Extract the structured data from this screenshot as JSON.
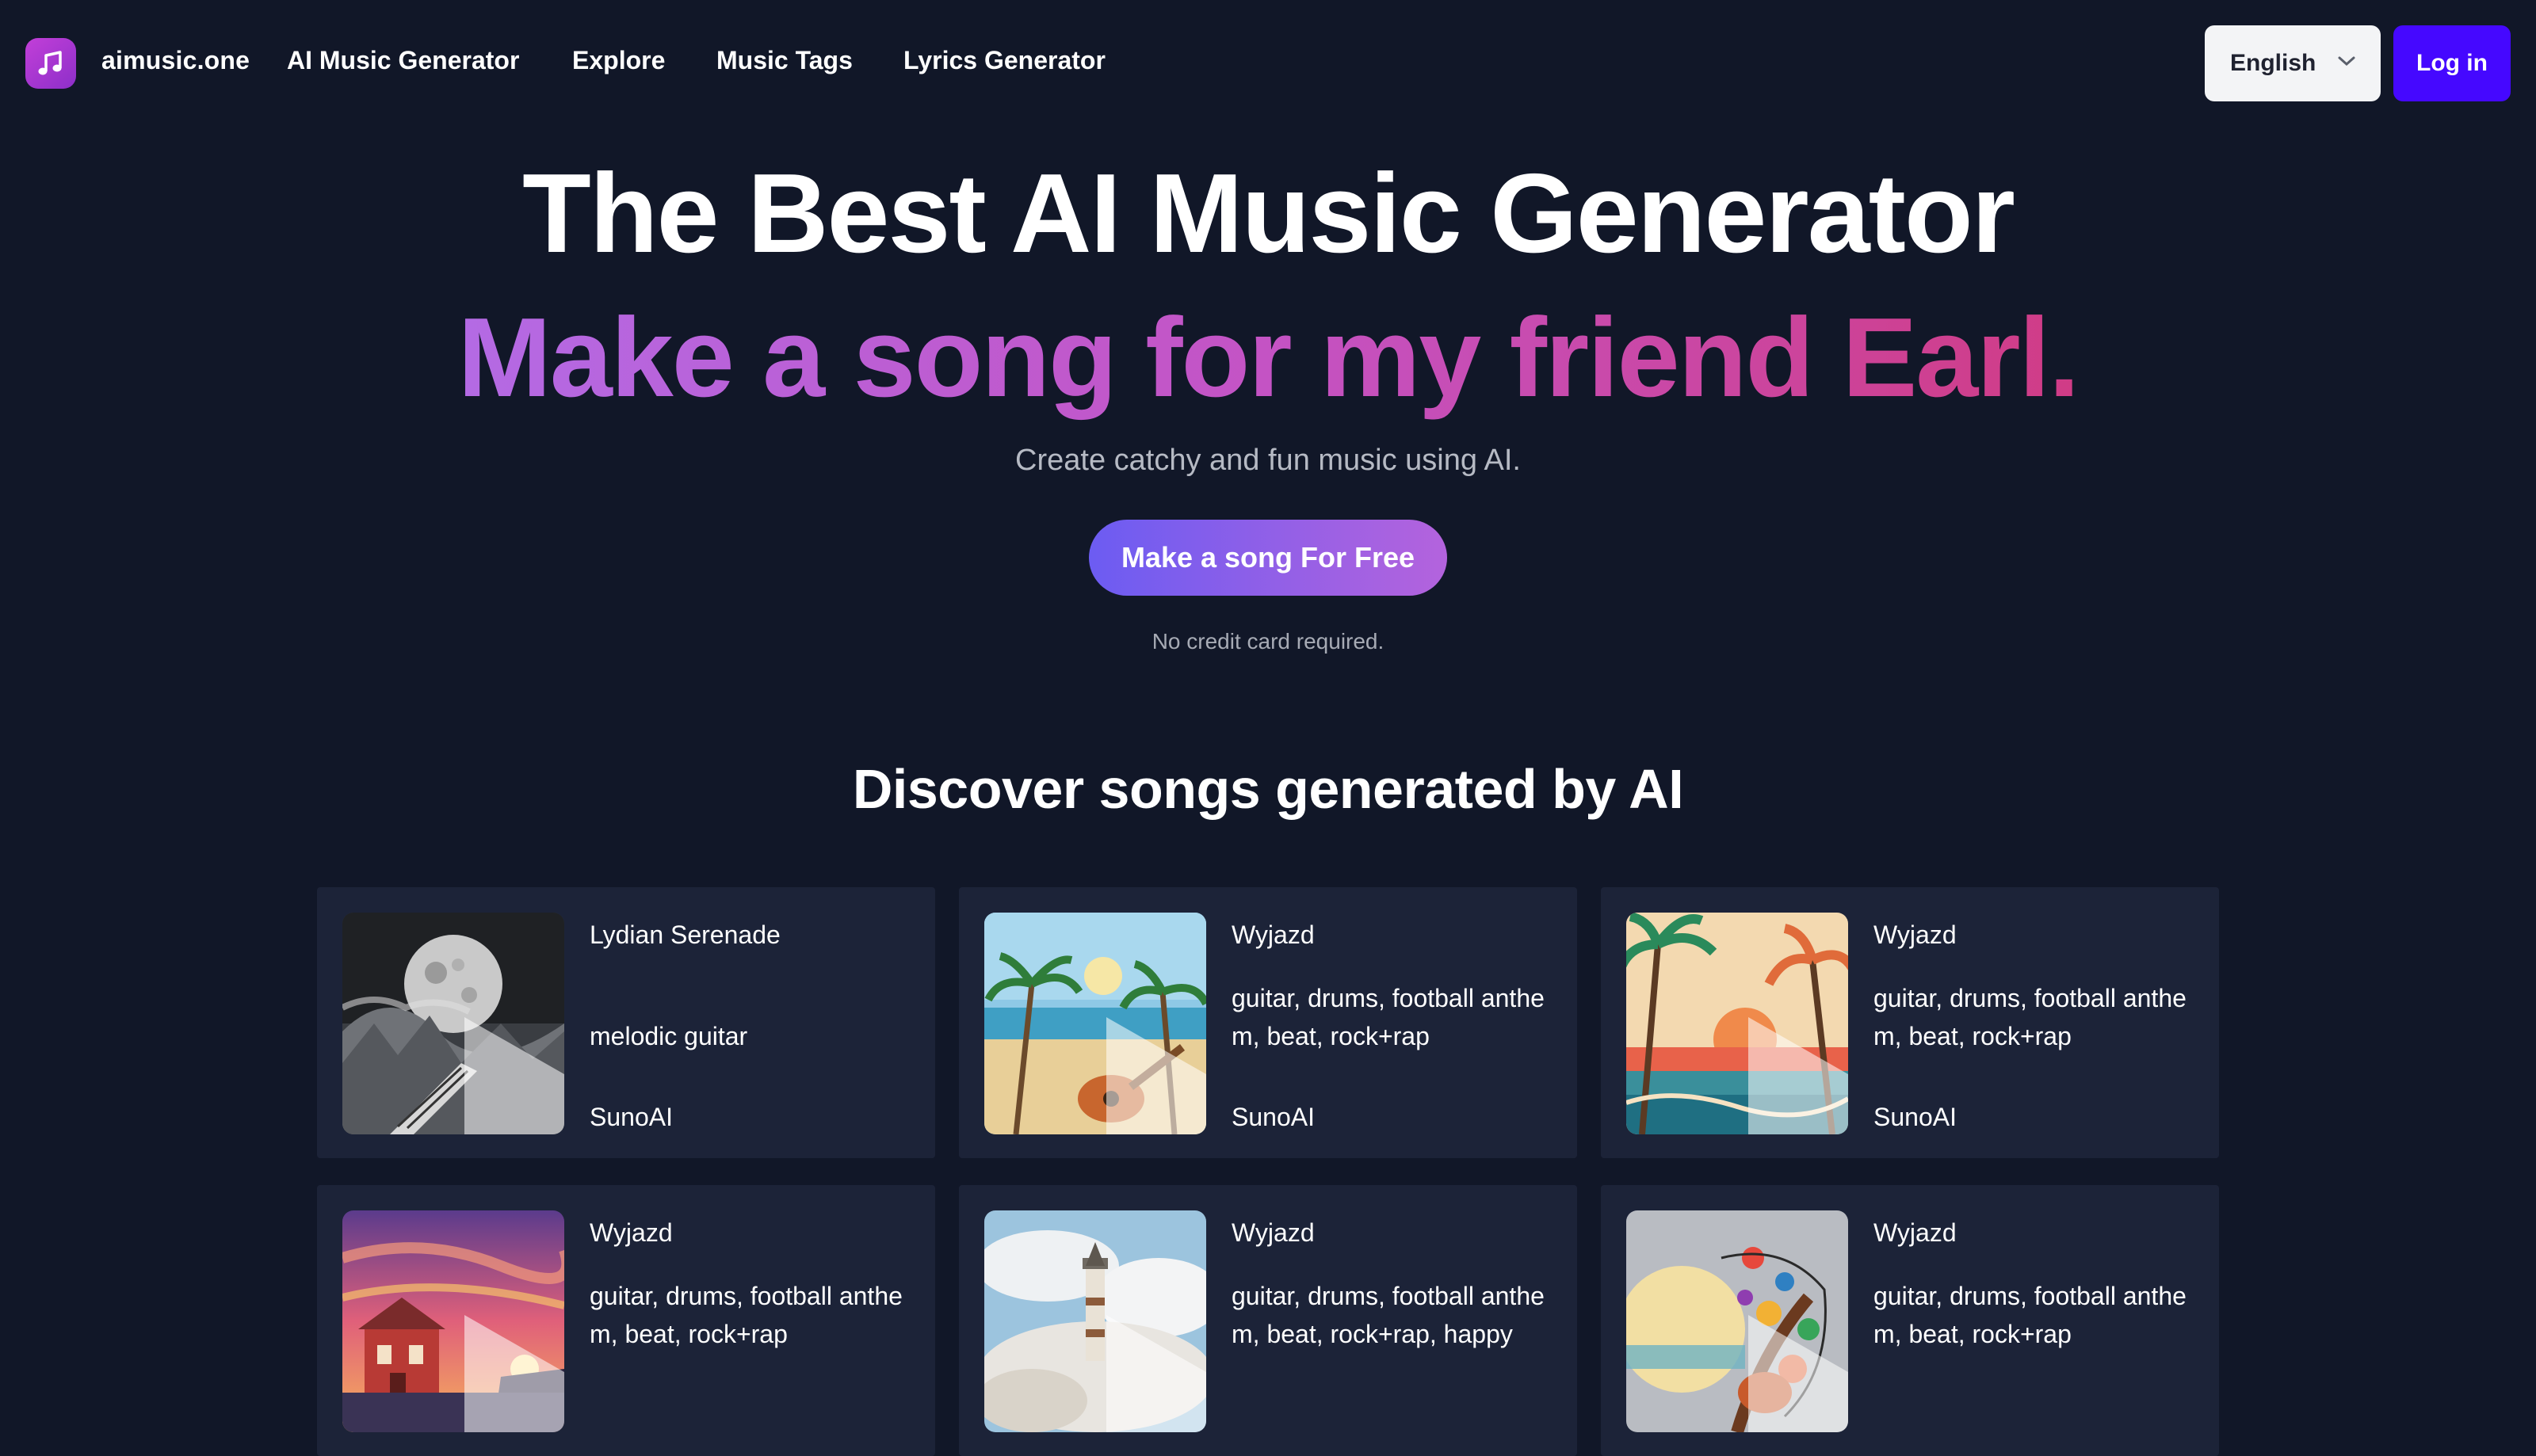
{
  "header": {
    "brand": "aimusic.one",
    "links": [
      "AI Music Generator",
      "Explore",
      "Music Tags",
      "Lyrics Generator"
    ],
    "language": "English",
    "login_label": "Log in"
  },
  "hero": {
    "title": "The Best AI Music Generator",
    "subtitle": "Make a song for my friend Earl.",
    "tagline": "Create catchy and fun music using AI.",
    "cta_label": "Make a song For Free",
    "note": "No credit card required."
  },
  "discover": {
    "heading": "Discover songs generated by AI",
    "songs": [
      {
        "title": "Lydian Serenade",
        "tags": "melodic guitar",
        "source": "SunoAI",
        "artwork": "moon-landscape"
      },
      {
        "title": "Wyjazd",
        "tags": "guitar, drums, football anthem, beat, rock+rap",
        "source": "SunoAI",
        "artwork": "beach-guitar"
      },
      {
        "title": "Wyjazd",
        "tags": "guitar, drums, football anthem, beat, rock+rap",
        "source": "SunoAI",
        "artwork": "tropical-sunset"
      },
      {
        "title": "Wyjazd",
        "tags": "guitar, drums, football anthem, beat, rock+rap",
        "source": "",
        "artwork": "red-house-sunset"
      },
      {
        "title": "Wyjazd",
        "tags": "guitar, drums, football anthem, beat, rock+rap, happy",
        "source": "",
        "artwork": "lighthouse-clouds"
      },
      {
        "title": "Wyjazd",
        "tags": "guitar, drums, football anthem, beat, rock+rap",
        "source": "",
        "artwork": "guitar-collage"
      }
    ]
  },
  "colors": {
    "background": "#111728",
    "card": "#1c2338",
    "login_button": "#4508ff",
    "gradient_start": "#b46ae4",
    "gradient_end": "#d03c86"
  },
  "icons": {
    "logo": "music-note-icon",
    "language_chevron": "chevron-down-icon",
    "card_play": "play-icon"
  }
}
